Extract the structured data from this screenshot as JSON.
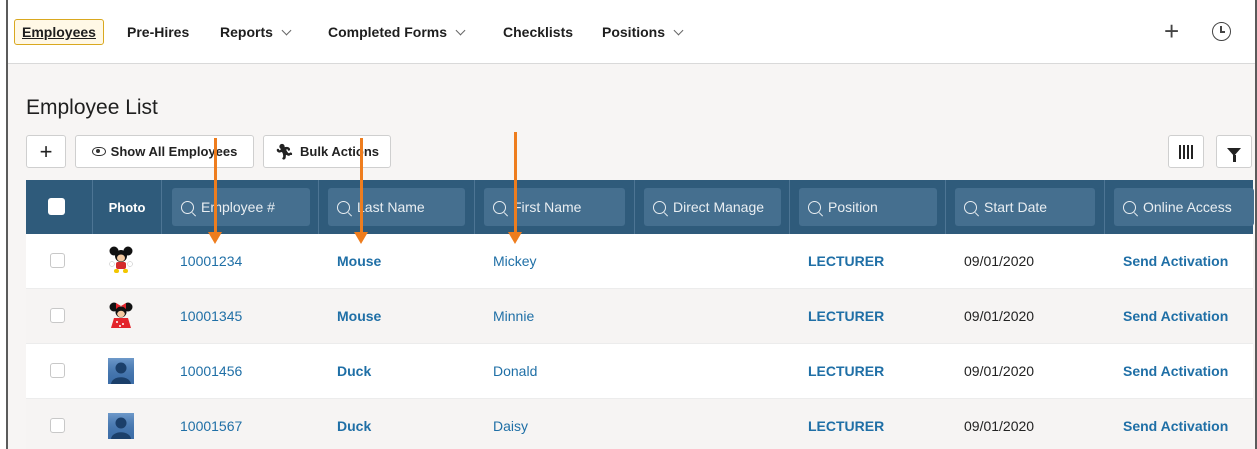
{
  "nav": {
    "items": [
      {
        "label": "Employees",
        "dropdown": false,
        "active": true
      },
      {
        "label": "Pre-Hires",
        "dropdown": false
      },
      {
        "label": "Reports",
        "dropdown": true
      },
      {
        "label": "Completed Forms",
        "dropdown": true
      },
      {
        "label": "Checklists",
        "dropdown": false
      },
      {
        "label": "Positions",
        "dropdown": true
      }
    ],
    "icons": [
      "plus-icon",
      "clock-icon"
    ]
  },
  "page": {
    "title": "Employee List"
  },
  "toolbar": {
    "add_label": "+",
    "show_all_label": "Show All Employees",
    "bulk_actions_label": "Bulk Actions"
  },
  "table": {
    "columns": {
      "photo": "Photo",
      "employee_no": "Employee #",
      "last_name": "Last Name",
      "first_name": "First Name",
      "direct_manager": "Direct Manage",
      "position": "Position",
      "start_date": "Start Date",
      "online_access": "Online Access"
    },
    "rows": [
      {
        "employee_no": "10001234",
        "last_name": "Mouse",
        "first_name": "Mickey",
        "direct_manager": "",
        "position": "LECTURER",
        "start_date": "09/01/2020",
        "online_access": "Send Activation",
        "photo": "mickey"
      },
      {
        "employee_no": "10001345",
        "last_name": "Mouse",
        "first_name": "Minnie",
        "direct_manager": "",
        "position": "LECTURER",
        "start_date": "09/01/2020",
        "online_access": "Send Activation",
        "photo": "minnie"
      },
      {
        "employee_no": "10001456",
        "last_name": "Duck",
        "first_name": "Donald",
        "direct_manager": "",
        "position": "LECTURER",
        "start_date": "09/01/2020",
        "online_access": "Send Activation",
        "photo": "placeholder"
      },
      {
        "employee_no": "10001567",
        "last_name": "Duck",
        "first_name": "Daisy",
        "direct_manager": "",
        "position": "LECTURER",
        "start_date": "09/01/2020",
        "online_access": "Send Activation",
        "photo": "placeholder"
      }
    ]
  },
  "colors": {
    "header_bg": "#2f5b7b",
    "link": "#1f6fa6",
    "annotation_arrow": "#ee7d1e",
    "active_tab_border": "#d9a81f"
  }
}
